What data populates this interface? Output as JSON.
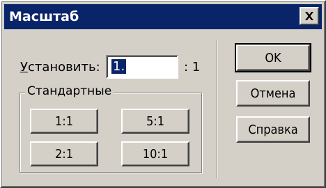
{
  "window": {
    "title": "Масштаб",
    "close_icon": "close-x-icon"
  },
  "scale": {
    "label": "Установить:",
    "label_underline_char": "У",
    "label_rest": "становить:",
    "value": "1.",
    "suffix": ": 1"
  },
  "standard": {
    "group_label": "Стандартные",
    "buttons": [
      "1:1",
      "5:1",
      "2:1",
      "10:1"
    ]
  },
  "actions": {
    "ok": "OK",
    "cancel": "Отмена",
    "help": "Справка"
  },
  "colors": {
    "titlebar": "#0a246a",
    "face": "#d4d0c8",
    "selection": "#0a246a"
  }
}
